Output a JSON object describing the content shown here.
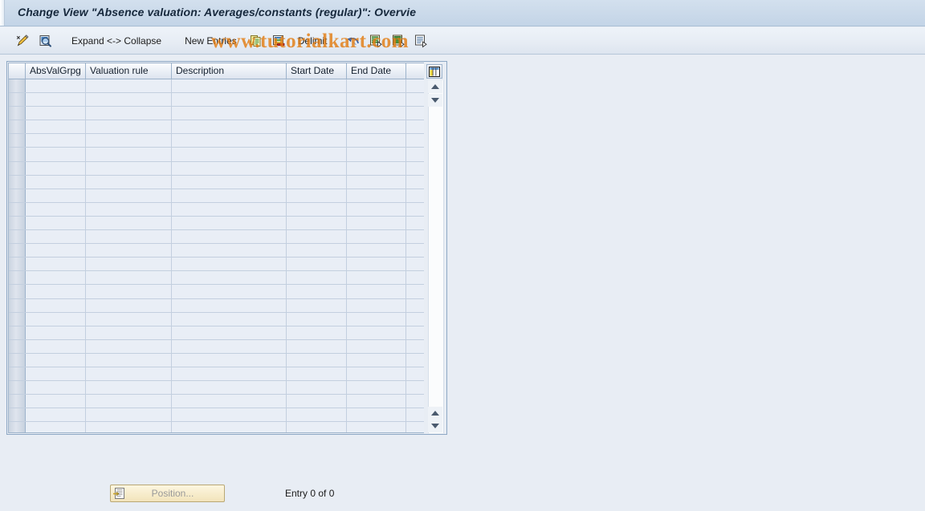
{
  "window": {
    "title": "Change View \"Absence valuation: Averages/constants (regular)\": Overvie"
  },
  "toolbar": {
    "items": [
      {
        "name": "display-change-toggle",
        "icon": "pencil-icon",
        "label": ""
      },
      {
        "name": "check-entries",
        "icon": "magnifier-document-icon",
        "label": ""
      },
      {
        "name": "expand-collapse",
        "icon": "",
        "label": "Expand <-> Collapse"
      },
      {
        "name": "new-entries",
        "icon": "",
        "label": "New Entries"
      },
      {
        "name": "copy-as",
        "icon": "copy-icon",
        "label": ""
      },
      {
        "name": "delete",
        "icon": "delete-row-icon",
        "label": ""
      },
      {
        "name": "delimit",
        "icon": "",
        "label": "Delimit"
      },
      {
        "name": "undo-change",
        "icon": "undo-icon",
        "label": ""
      },
      {
        "name": "previous-entry",
        "icon": "prev-entry-icon",
        "label": ""
      },
      {
        "name": "next-entry",
        "icon": "next-entry-icon",
        "label": ""
      },
      {
        "name": "select-all-detail",
        "icon": "detail-icon",
        "label": ""
      }
    ],
    "expand_collapse_label": "Expand <-> Collapse",
    "new_entries_label": "New Entries",
    "delimit_label": "Delimit"
  },
  "table": {
    "columns": [
      {
        "key": "absvalgrpg",
        "label": "AbsValGrpg"
      },
      {
        "key": "valuation_rule",
        "label": "Valuation rule"
      },
      {
        "key": "description",
        "label": "Description"
      },
      {
        "key": "start_date",
        "label": "Start Date"
      },
      {
        "key": "end_date",
        "label": "End Date"
      }
    ],
    "rows": [],
    "empty_row_count": 26,
    "config_icon": "table-settings-icon"
  },
  "scrollbar": {
    "up_icon": "scroll-up-icon",
    "down_icon": "scroll-down-icon"
  },
  "footer": {
    "position_button_label": "Position...",
    "position_button_icon": "position-icon",
    "entry_count_text": "Entry 0 of 0"
  },
  "watermark": {
    "text": "www.tutorialkart.com"
  },
  "colors": {
    "titlebar": "#cbdaea",
    "toolbar": "#e6ecf4",
    "page_background": "#e8edf4",
    "grid_cell": "#e9eef6",
    "grid_line": "#c3cfdf",
    "accent_orange": "#e27c12"
  }
}
